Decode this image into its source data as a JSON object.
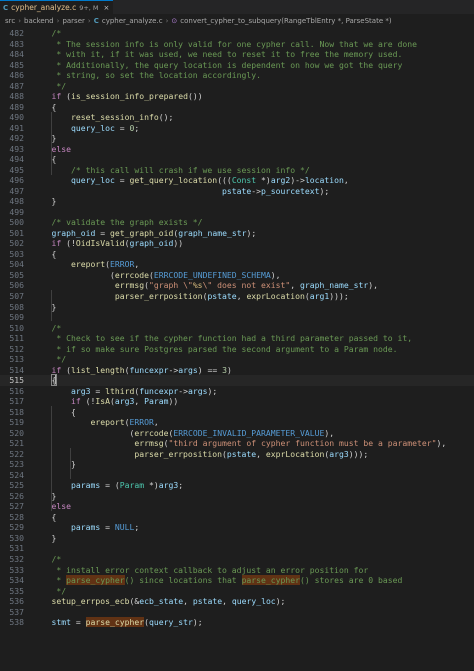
{
  "tab": {
    "file_icon": "C",
    "filename": "cypher_analyze.c",
    "status": "9+, M",
    "close": "×"
  },
  "breadcrumb": {
    "items": [
      "src",
      "backend",
      "parser"
    ],
    "file_icon": "C",
    "file": "cypher_analyze.c",
    "function_icon": "⊙",
    "function": "convert_cypher_to_subquery(RangeTblEntry *, ParseState *)"
  },
  "editor": {
    "current_line": 515,
    "lines": [
      {
        "n": "482",
        "t": [
          [
            "cm",
            "    /*"
          ]
        ]
      },
      {
        "n": "483",
        "t": [
          [
            "cm",
            "     * The session info is only valid for one cypher call. Now that we are done"
          ]
        ]
      },
      {
        "n": "484",
        "t": [
          [
            "cm",
            "     * with it, if it was used, we need to reset it to free the memory used."
          ]
        ]
      },
      {
        "n": "485",
        "t": [
          [
            "cm",
            "     * Additionally, the query location is dependent on how we got the query"
          ]
        ]
      },
      {
        "n": "486",
        "t": [
          [
            "cm",
            "     * string, so set the location accordingly."
          ]
        ]
      },
      {
        "n": "487",
        "t": [
          [
            "cm",
            "     */"
          ]
        ]
      },
      {
        "n": "488",
        "t": [
          [
            "kw",
            "    if "
          ],
          [
            "pl",
            "("
          ],
          [
            "fn",
            "is_session_info_prepared"
          ],
          [
            "pl",
            "())"
          ]
        ]
      },
      {
        "n": "489",
        "t": [
          [
            "pl",
            "    {"
          ]
        ]
      },
      {
        "n": "490",
        "t": [
          [
            "fn",
            "        reset_session_info"
          ],
          [
            "pl",
            "();"
          ]
        ]
      },
      {
        "n": "491",
        "t": [
          [
            "vr",
            "        query_loc"
          ],
          [
            "pl",
            " = "
          ],
          [
            "nm",
            "0"
          ],
          [
            "pl",
            ";"
          ]
        ]
      },
      {
        "n": "492",
        "t": [
          [
            "pl",
            "    }"
          ]
        ]
      },
      {
        "n": "493",
        "t": [
          [
            "kw",
            "    else"
          ]
        ]
      },
      {
        "n": "494",
        "t": [
          [
            "pl",
            "    {"
          ]
        ]
      },
      {
        "n": "495",
        "t": [
          [
            "cm",
            "        /* this call will crash if we use session info */"
          ]
        ]
      },
      {
        "n": "496",
        "t": [
          [
            "vr",
            "        query_loc"
          ],
          [
            "pl",
            " = "
          ],
          [
            "fn",
            "get_query_location"
          ],
          [
            "pl",
            "((("
          ],
          [
            "ty",
            "Const"
          ],
          [
            "pl",
            " *)"
          ],
          [
            "vr",
            "arg2"
          ],
          [
            "pl",
            ")->"
          ],
          [
            "vr",
            "location"
          ],
          [
            "pl",
            ","
          ]
        ]
      },
      {
        "n": "497",
        "t": [
          [
            "vr",
            "                                       pstate"
          ],
          [
            "pl",
            "->"
          ],
          [
            "vr",
            "p_sourcetext"
          ],
          [
            "pl",
            ");"
          ]
        ]
      },
      {
        "n": "498",
        "t": [
          [
            "pl",
            "    }"
          ]
        ]
      },
      {
        "n": "499",
        "t": [
          [
            "pl",
            ""
          ]
        ]
      },
      {
        "n": "500",
        "t": [
          [
            "cm",
            "    /* validate the graph exists */"
          ]
        ]
      },
      {
        "n": "501",
        "t": [
          [
            "vr",
            "    graph_oid"
          ],
          [
            "pl",
            " = "
          ],
          [
            "fn",
            "get_graph_oid"
          ],
          [
            "pl",
            "("
          ],
          [
            "vr",
            "graph_name_str"
          ],
          [
            "pl",
            ");"
          ]
        ]
      },
      {
        "n": "502",
        "t": [
          [
            "kw",
            "    if "
          ],
          [
            "pl",
            "(!"
          ],
          [
            "fn",
            "OidIsValid"
          ],
          [
            "pl",
            "("
          ],
          [
            "vr",
            "graph_oid"
          ],
          [
            "pl",
            "))"
          ]
        ]
      },
      {
        "n": "503",
        "t": [
          [
            "pl",
            "    {"
          ]
        ]
      },
      {
        "n": "504",
        "t": [
          [
            "fn",
            "        ereport"
          ],
          [
            "pl",
            "("
          ],
          [
            "mc",
            "ERROR"
          ],
          [
            "pl",
            ","
          ]
        ]
      },
      {
        "n": "505",
        "t": [
          [
            "pl",
            "                ("
          ],
          [
            "fn",
            "errcode"
          ],
          [
            "pl",
            "("
          ],
          [
            "mc",
            "ERRCODE_UNDEFINED_SCHEMA"
          ],
          [
            "pl",
            "),"
          ]
        ]
      },
      {
        "n": "506",
        "t": [
          [
            "fn",
            "                 errmsg"
          ],
          [
            "pl",
            "("
          ],
          [
            "st",
            "\"graph \\\""
          ],
          [
            "es",
            "%s"
          ],
          [
            "st",
            "\\\" does not exist\""
          ],
          [
            "pl",
            ", "
          ],
          [
            "vr",
            "graph_name_str"
          ],
          [
            "pl",
            "),"
          ]
        ]
      },
      {
        "n": "507",
        "t": [
          [
            "fn",
            "                 parser_errposition"
          ],
          [
            "pl",
            "("
          ],
          [
            "vr",
            "pstate"
          ],
          [
            "pl",
            ", "
          ],
          [
            "fn",
            "exprLocation"
          ],
          [
            "pl",
            "("
          ],
          [
            "vr",
            "arg1"
          ],
          [
            "pl",
            ")));"
          ]
        ]
      },
      {
        "n": "508",
        "t": [
          [
            "pl",
            "    }"
          ]
        ]
      },
      {
        "n": "509",
        "t": [
          [
            "pl",
            ""
          ]
        ]
      },
      {
        "n": "510",
        "t": [
          [
            "cm",
            "    /*"
          ]
        ]
      },
      {
        "n": "511",
        "t": [
          [
            "cm",
            "     * Check to see if the cypher function had a third parameter passed to it,"
          ]
        ]
      },
      {
        "n": "512",
        "t": [
          [
            "cm",
            "     * if so make sure Postgres parsed the second argument to a Param node."
          ]
        ]
      },
      {
        "n": "513",
        "t": [
          [
            "cm",
            "     */"
          ]
        ]
      },
      {
        "n": "514",
        "t": [
          [
            "kw",
            "    if "
          ],
          [
            "pl",
            "("
          ],
          [
            "fn",
            "list_length"
          ],
          [
            "pl",
            "("
          ],
          [
            "vr",
            "funcexpr"
          ],
          [
            "pl",
            "->"
          ],
          [
            "vr",
            "args"
          ],
          [
            "pl",
            ") == "
          ],
          [
            "nm",
            "3"
          ],
          [
            "pl",
            ")"
          ]
        ]
      },
      {
        "n": "515",
        "t": [
          [
            "pl",
            "    "
          ],
          [
            "bm",
            "{"
          ]
        ],
        "cursor": true
      },
      {
        "n": "516",
        "t": [
          [
            "vr",
            "        arg3"
          ],
          [
            "pl",
            " = "
          ],
          [
            "fn",
            "lthird"
          ],
          [
            "pl",
            "("
          ],
          [
            "vr",
            "funcexpr"
          ],
          [
            "pl",
            "->"
          ],
          [
            "vr",
            "args"
          ],
          [
            "pl",
            ");"
          ]
        ]
      },
      {
        "n": "517",
        "t": [
          [
            "kw",
            "        if "
          ],
          [
            "pl",
            "(!"
          ],
          [
            "fn",
            "IsA"
          ],
          [
            "pl",
            "("
          ],
          [
            "vr",
            "arg3"
          ],
          [
            "pl",
            ", "
          ],
          [
            "vr",
            "Param"
          ],
          [
            "pl",
            "))"
          ]
        ]
      },
      {
        "n": "518",
        "t": [
          [
            "pl",
            "        {"
          ]
        ]
      },
      {
        "n": "519",
        "t": [
          [
            "fn",
            "            ereport"
          ],
          [
            "pl",
            "("
          ],
          [
            "mc",
            "ERROR"
          ],
          [
            "pl",
            ","
          ]
        ]
      },
      {
        "n": "520",
        "t": [
          [
            "pl",
            "                    ("
          ],
          [
            "fn",
            "errcode"
          ],
          [
            "pl",
            "("
          ],
          [
            "mc",
            "ERRCODE_INVALID_PARAMETER_VALUE"
          ],
          [
            "pl",
            "),"
          ]
        ]
      },
      {
        "n": "521",
        "t": [
          [
            "fn",
            "                     errmsg"
          ],
          [
            "pl",
            "("
          ],
          [
            "st",
            "\"third argument of cypher function must be a parameter\""
          ],
          [
            "pl",
            "),"
          ]
        ]
      },
      {
        "n": "522",
        "t": [
          [
            "fn",
            "                     parser_errposition"
          ],
          [
            "pl",
            "("
          ],
          [
            "vr",
            "pstate"
          ],
          [
            "pl",
            ", "
          ],
          [
            "fn",
            "exprLocation"
          ],
          [
            "pl",
            "("
          ],
          [
            "vr",
            "arg3"
          ],
          [
            "pl",
            ")));"
          ]
        ]
      },
      {
        "n": "523",
        "t": [
          [
            "pl",
            "        }"
          ]
        ]
      },
      {
        "n": "524",
        "t": [
          [
            "pl",
            ""
          ]
        ]
      },
      {
        "n": "525",
        "t": [
          [
            "vr",
            "        params"
          ],
          [
            "pl",
            " = ("
          ],
          [
            "ty",
            "Param"
          ],
          [
            "pl",
            " *)"
          ],
          [
            "vr",
            "arg3"
          ],
          [
            "pl",
            ";"
          ]
        ]
      },
      {
        "n": "526",
        "t": [
          [
            "pl",
            "    }"
          ]
        ]
      },
      {
        "n": "527",
        "t": [
          [
            "kw",
            "    else"
          ]
        ]
      },
      {
        "n": "528",
        "t": [
          [
            "pl",
            "    {"
          ]
        ]
      },
      {
        "n": "529",
        "t": [
          [
            "vr",
            "        params"
          ],
          [
            "pl",
            " = "
          ],
          [
            "mc",
            "NULL"
          ],
          [
            "pl",
            ";"
          ]
        ]
      },
      {
        "n": "530",
        "t": [
          [
            "pl",
            "    }"
          ]
        ]
      },
      {
        "n": "531",
        "t": [
          [
            "pl",
            ""
          ]
        ]
      },
      {
        "n": "532",
        "t": [
          [
            "cm",
            "    /*"
          ]
        ]
      },
      {
        "n": "533",
        "t": [
          [
            "cm",
            "     * install error context callback to adjust an error position for"
          ]
        ]
      },
      {
        "n": "534",
        "t": [
          [
            "cm",
            "     * "
          ],
          [
            "hlcm",
            "parse_cypher"
          ],
          [
            "cm",
            "() since locations that "
          ],
          [
            "hlcm",
            "parse_cypher"
          ],
          [
            "cm",
            "() stores are 0 based"
          ]
        ]
      },
      {
        "n": "535",
        "t": [
          [
            "cm",
            "     */"
          ]
        ]
      },
      {
        "n": "536",
        "t": [
          [
            "fn",
            "    setup_errpos_ecb"
          ],
          [
            "pl",
            "(&"
          ],
          [
            "vr",
            "ecb_state"
          ],
          [
            "pl",
            ", "
          ],
          [
            "vr",
            "pstate"
          ],
          [
            "pl",
            ", "
          ],
          [
            "vr",
            "query_loc"
          ],
          [
            "pl",
            ");"
          ]
        ]
      },
      {
        "n": "537",
        "t": [
          [
            "pl",
            ""
          ]
        ]
      },
      {
        "n": "538",
        "t": [
          [
            "vr",
            "    stmt"
          ],
          [
            "pl",
            " = "
          ],
          [
            "hlfn",
            "parse_cypher"
          ],
          [
            "pl",
            "("
          ],
          [
            "vr",
            "query_str"
          ],
          [
            "pl",
            ");"
          ]
        ]
      }
    ]
  }
}
